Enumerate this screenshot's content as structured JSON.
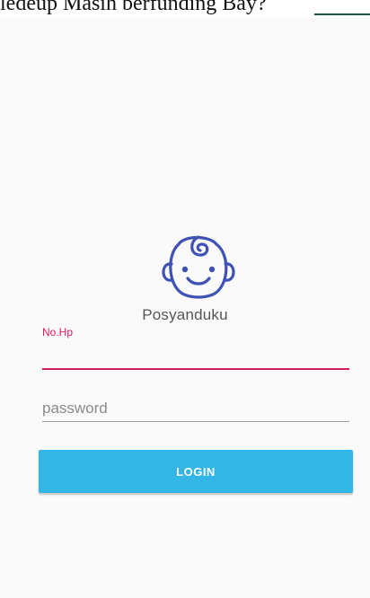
{
  "top_strip": {
    "partial_text": "ledeup Masih berfunding Bay?"
  },
  "app": {
    "name": "Posyanduku",
    "logo_icon": "baby-face-icon",
    "accent_color": "#d81b60",
    "logo_color": "#3f51b5"
  },
  "form": {
    "phone_label": "No.Hp",
    "phone_value": "",
    "password_placeholder": "password",
    "password_value": "",
    "login_label": "LOGIN",
    "button_color": "#33b5e5"
  }
}
